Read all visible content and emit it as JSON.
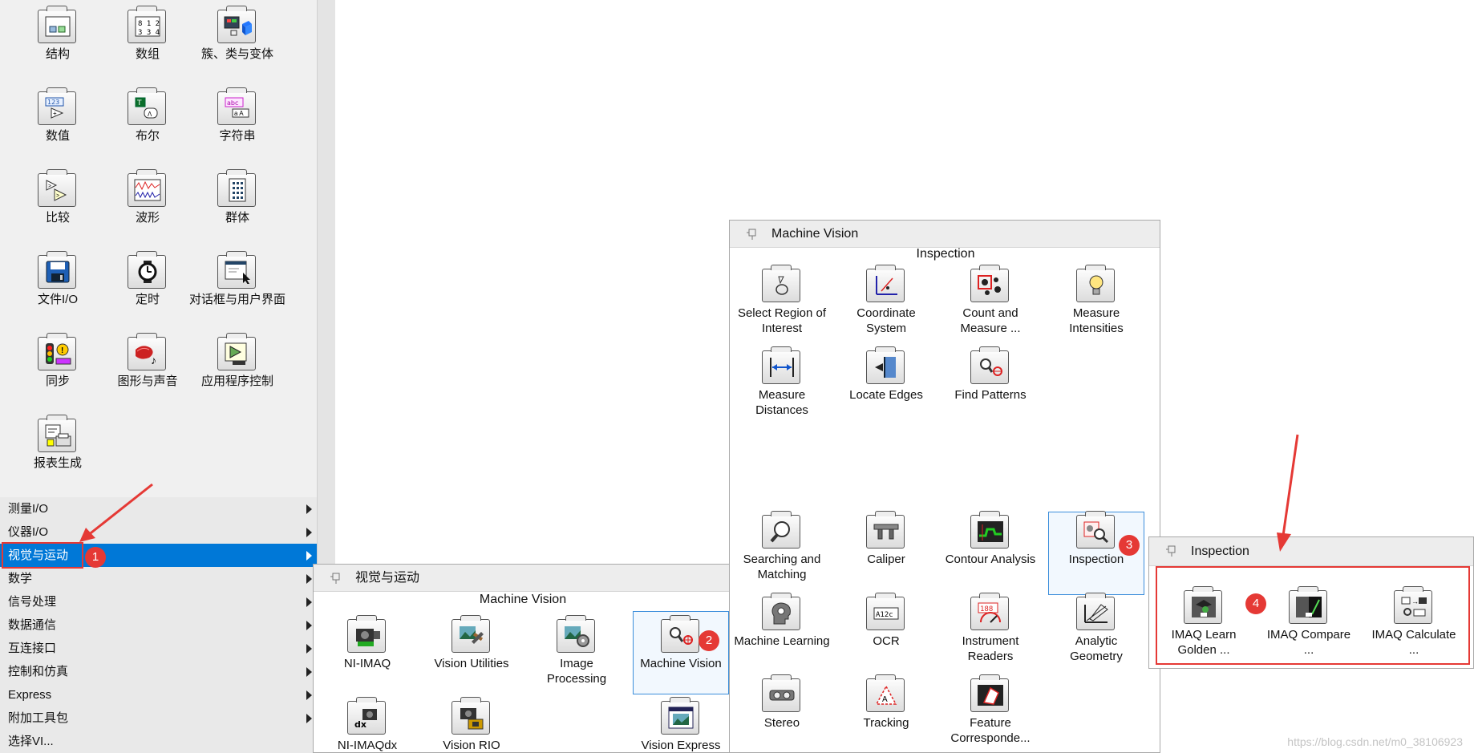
{
  "palette": {
    "tiles": [
      {
        "label": "结构",
        "icon": "structure-icon"
      },
      {
        "label": "数组",
        "icon": "array-icon"
      },
      {
        "label": "簇、类与变体",
        "icon": "cluster-class-variant-icon"
      },
      {
        "label": "数值",
        "icon": "numeric-icon"
      },
      {
        "label": "布尔",
        "icon": "boolean-icon"
      },
      {
        "label": "字符串",
        "icon": "string-icon"
      },
      {
        "label": "比较",
        "icon": "comparison-icon"
      },
      {
        "label": "波形",
        "icon": "waveform-icon"
      },
      {
        "label": "群体",
        "icon": "cluster-icon"
      },
      {
        "label": "文件I/O",
        "icon": "file-io-icon"
      },
      {
        "label": "定时",
        "icon": "timing-icon"
      },
      {
        "label": "对话框与用户界面",
        "icon": "dialog-ui-icon"
      },
      {
        "label": "同步",
        "icon": "synchronization-icon"
      },
      {
        "label": "图形与声音",
        "icon": "graphics-sound-icon"
      },
      {
        "label": "应用程序控制",
        "icon": "application-control-icon"
      },
      {
        "label": "报表生成",
        "icon": "report-generation-icon"
      }
    ],
    "categories": [
      {
        "label": "测量I/O"
      },
      {
        "label": "仪器I/O"
      },
      {
        "label": "视觉与运动",
        "selected": true
      },
      {
        "label": "数学"
      },
      {
        "label": "信号处理"
      },
      {
        "label": "数据通信"
      },
      {
        "label": "互连接口"
      },
      {
        "label": "控制和仿真"
      },
      {
        "label": "Express"
      },
      {
        "label": "附加工具包"
      },
      {
        "label": "选择VI..."
      }
    ]
  },
  "vision_motion_panel": {
    "title": "视觉与运动",
    "section": "Machine Vision",
    "tiles": [
      {
        "label": "NI-IMAQ",
        "icon": "ni-imaq-icon"
      },
      {
        "label": "Vision Utilities",
        "icon": "vision-utilities-icon"
      },
      {
        "label": "Image Processing",
        "icon": "image-processing-icon"
      },
      {
        "label": "Machine Vision",
        "icon": "machine-vision-icon"
      },
      {
        "label": "NI-IMAQdx",
        "icon": "ni-imaqdx-icon"
      },
      {
        "label": "Vision RIO",
        "icon": "vision-rio-icon"
      },
      {
        "label": "Vision Express",
        "icon": "vision-express-icon"
      }
    ]
  },
  "machine_vision_panel": {
    "title": "Machine Vision",
    "section": "Inspection",
    "tiles": [
      {
        "label": "Select Region of Interest",
        "icon": "select-roi-icon"
      },
      {
        "label": "Coordinate System",
        "icon": "coordinate-system-icon"
      },
      {
        "label": "Count and Measure ...",
        "icon": "count-measure-icon"
      },
      {
        "label": "Measure Intensities",
        "icon": "measure-intensities-icon"
      },
      {
        "label": "Measure Distances",
        "icon": "measure-distances-icon"
      },
      {
        "label": "Locate Edges",
        "icon": "locate-edges-icon"
      },
      {
        "label": "Find Patterns",
        "icon": "find-patterns-icon"
      },
      {
        "label": "Searching and Matching",
        "icon": "searching-matching-icon"
      },
      {
        "label": "Caliper",
        "icon": "caliper-icon"
      },
      {
        "label": "Contour Analysis",
        "icon": "contour-analysis-icon"
      },
      {
        "label": "Inspection",
        "icon": "inspection-icon"
      },
      {
        "label": "Machine Learning",
        "icon": "machine-learning-icon"
      },
      {
        "label": "OCR",
        "icon": "ocr-icon"
      },
      {
        "label": "Instrument Readers",
        "icon": "instrument-readers-icon"
      },
      {
        "label": "Analytic Geometry",
        "icon": "analytic-geometry-icon"
      },
      {
        "label": "Stereo",
        "icon": "stereo-icon"
      },
      {
        "label": "Tracking",
        "icon": "tracking-icon"
      },
      {
        "label": "Feature Corresponde...",
        "icon": "feature-correspondence-icon"
      }
    ]
  },
  "inspection_panel": {
    "title": "Inspection",
    "tiles": [
      {
        "label": "IMAQ Learn Golden ...",
        "icon": "imaq-learn-golden-icon"
      },
      {
        "label": "IMAQ Compare ...",
        "icon": "imaq-compare-icon"
      },
      {
        "label": "IMAQ Calculate ...",
        "icon": "imaq-calculate-icon"
      }
    ]
  },
  "annotations": {
    "badges": [
      "1",
      "2",
      "3",
      "4"
    ],
    "accent_color": "#e53935",
    "selection_color": "#0078d7"
  },
  "watermark": "https://blog.csdn.net/m0_38106923"
}
